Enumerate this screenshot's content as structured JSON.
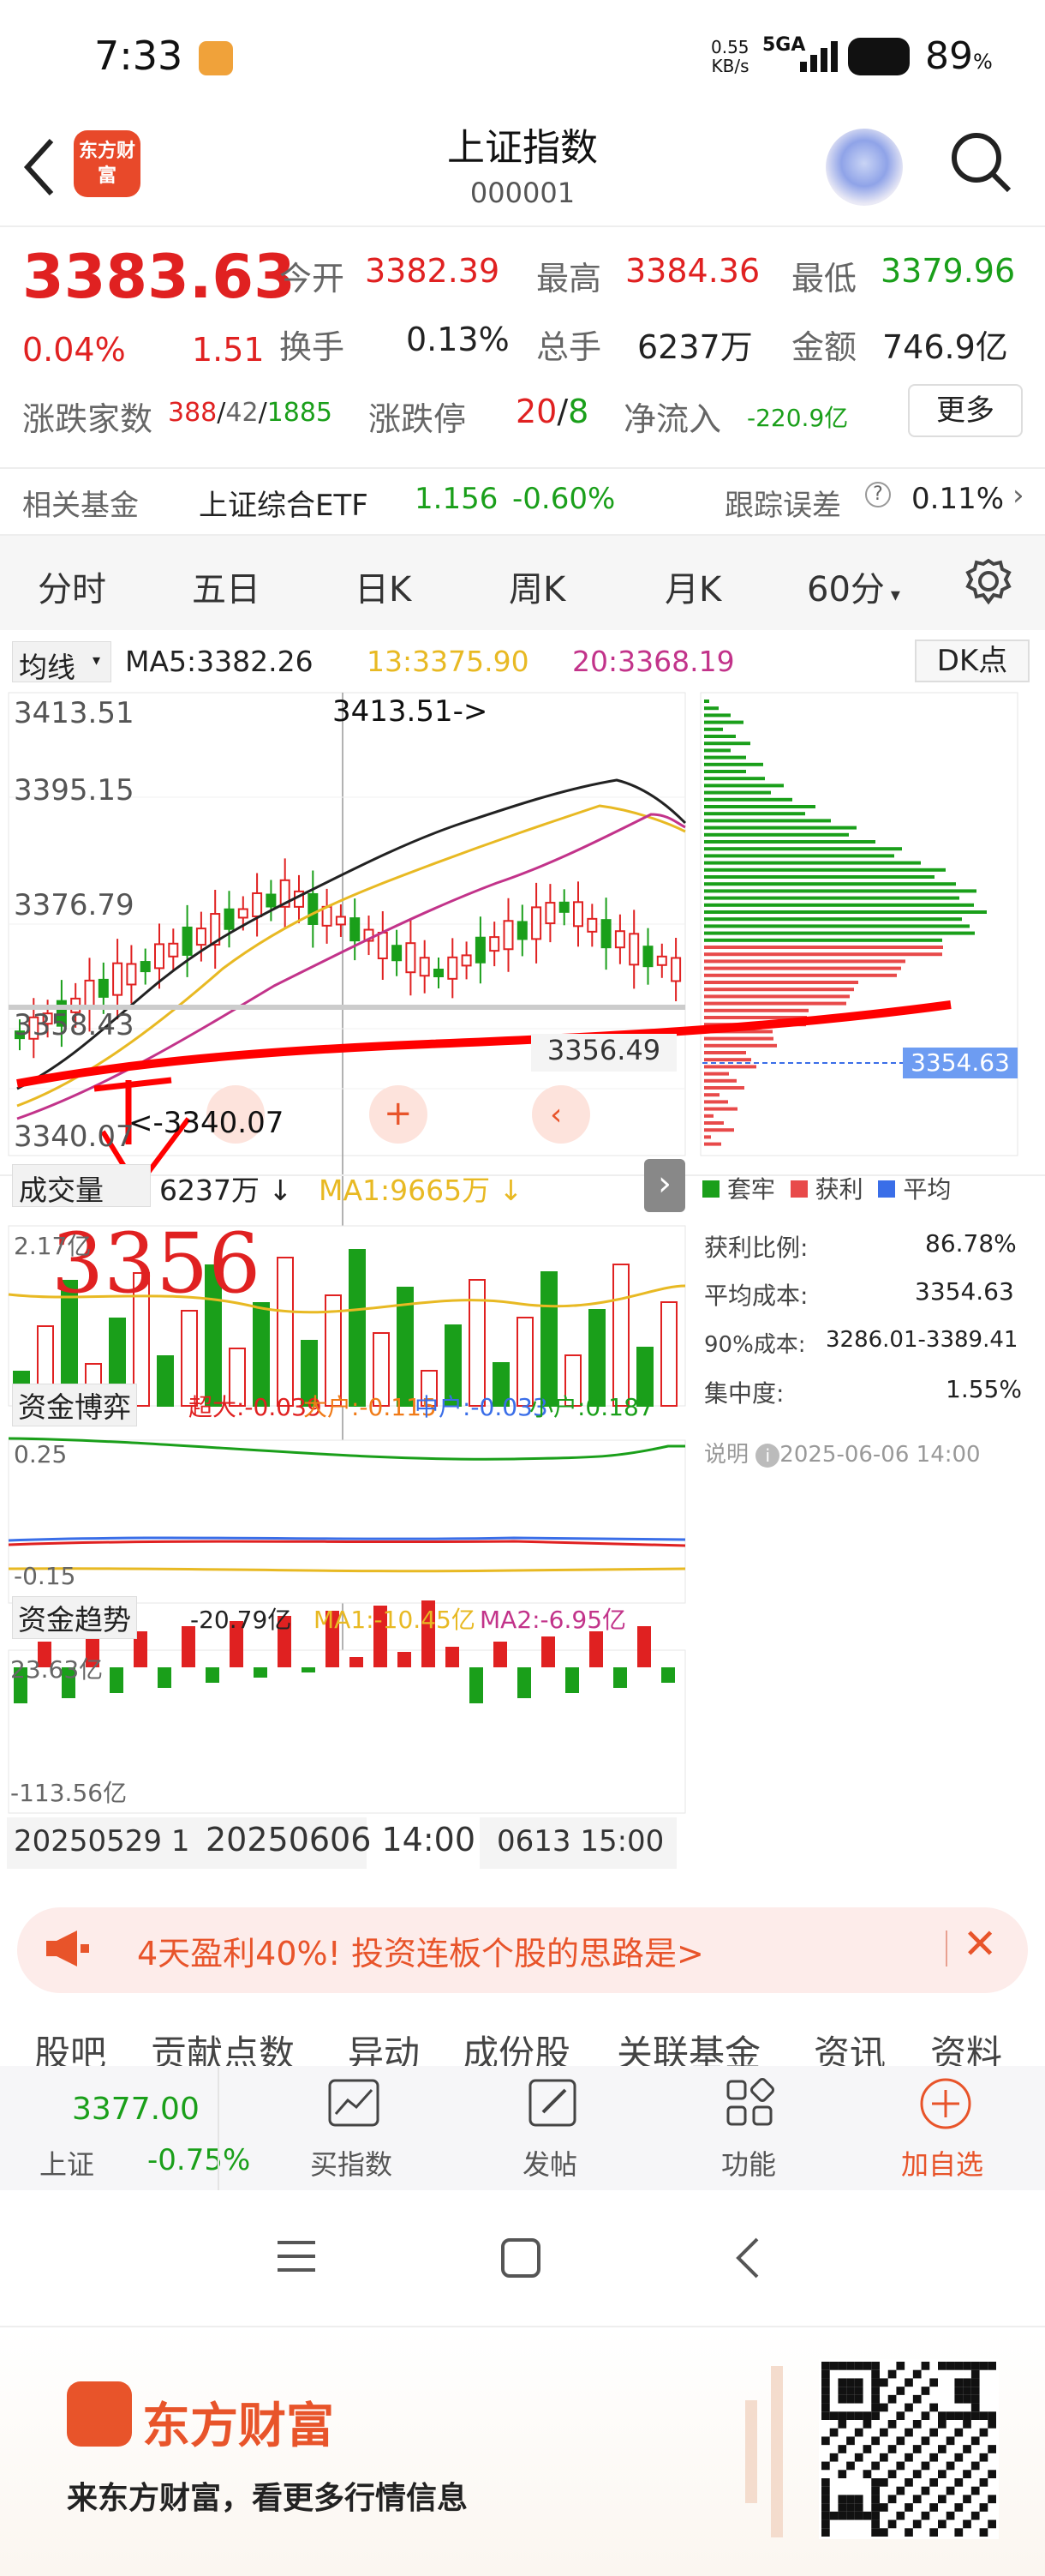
{
  "status": {
    "time": "7:33",
    "net_speed": "0.55",
    "net_unit": "KB/s",
    "network": "5GA",
    "battery": "89",
    "battery_unit": "%"
  },
  "header": {
    "logo_text": "东方财富",
    "title": "上证指数",
    "code": "000001"
  },
  "quote": {
    "price": "3383.63",
    "change_pct": "0.04%",
    "change": "1.51",
    "open_label": "今开",
    "open": "3382.39",
    "high_label": "最高",
    "high": "3384.36",
    "low_label": "最低",
    "low": "3379.96",
    "turnover_label": "换手",
    "turnover": "0.13%",
    "volume_label": "总手",
    "volume": "6237万",
    "amount_label": "金额",
    "amount": "746.9亿",
    "breadth_label": "涨跌家数",
    "up": "388",
    "flat": "42",
    "down": "1885",
    "limit_label": "涨跌停",
    "limit_up": "20",
    "limit_down": "8",
    "inflow_label": "净流入",
    "inflow": "-220.9亿",
    "more": "更多"
  },
  "fund": {
    "label": "相关基金",
    "name": "上证综合ETF",
    "price": "1.156",
    "change": "-0.60%",
    "track_label": "跟踪误差",
    "track": "0.11%"
  },
  "tabs": [
    "分时",
    "五日",
    "日K",
    "周K",
    "月K",
    "60分"
  ],
  "kline": {
    "ma_type": "均线",
    "ma5": "MA5:3382.26",
    "ma13": "13:3375.90",
    "ma20": "20:3368.19",
    "dk": "DK点",
    "y_labels": [
      "3413.51",
      "3395.15",
      "3376.79",
      "3358.43",
      "3340.07"
    ],
    "high_mark": "3413.51->",
    "low_mark": "<-3340.07",
    "cross_price": "3356.49",
    "cost_tag": "3354.63",
    "annotation": "3356"
  },
  "volume": {
    "label": "成交量",
    "value": "6237万",
    "ma1": "MA1:9665万",
    "y_top": "2.17亿"
  },
  "capital_game": {
    "label": "资金博弈",
    "super": "超大:-0.039",
    "large": "大户:-0.115",
    "mid": "中户:-0.033",
    "small": "小户:0.187",
    "y_top": "0.25",
    "y_bot": "-0.15"
  },
  "capital_trend": {
    "label": "资金趋势",
    "value": "-20.79亿",
    "ma1": "MA1:-10.45亿",
    "ma2": "MA2:-6.95亿",
    "y_top": "23.63亿",
    "y_bot": "-113.56亿"
  },
  "x_axis": [
    "20250529 1",
    "20250606 14:00",
    "0613 15:00"
  ],
  "chips": {
    "legend": [
      "套牢",
      "获利",
      "平均"
    ],
    "profit_label": "获利比例:",
    "profit": "86.78%",
    "cost_label": "平均成本:",
    "cost": "3354.63",
    "cost90_label": "90%成本:",
    "cost90": "3286.01-3389.41",
    "conc_label": "集中度:",
    "conc": "1.55%",
    "note_label": "说明",
    "note_time": "2025-06-06 14:00"
  },
  "banner": {
    "text": "4天盈利40%! 投资连板个股的思路是>"
  },
  "bottom_tabs": [
    "股吧",
    "贡献点数",
    "异动",
    "成份股",
    "关联基金",
    "资讯",
    "资料"
  ],
  "toolbar": {
    "index_price": "3377.00",
    "index_name": "上证",
    "index_change": "-0.75%",
    "buy": "买指数",
    "post": "发帖",
    "func": "功能",
    "add": "加自选"
  },
  "footer": {
    "brand": "东方财富",
    "slogan": "来东方财富，看更多行情信息"
  },
  "colors": {
    "up": "#e02121",
    "down": "#1a9f1a",
    "accent": "#f07b18"
  }
}
